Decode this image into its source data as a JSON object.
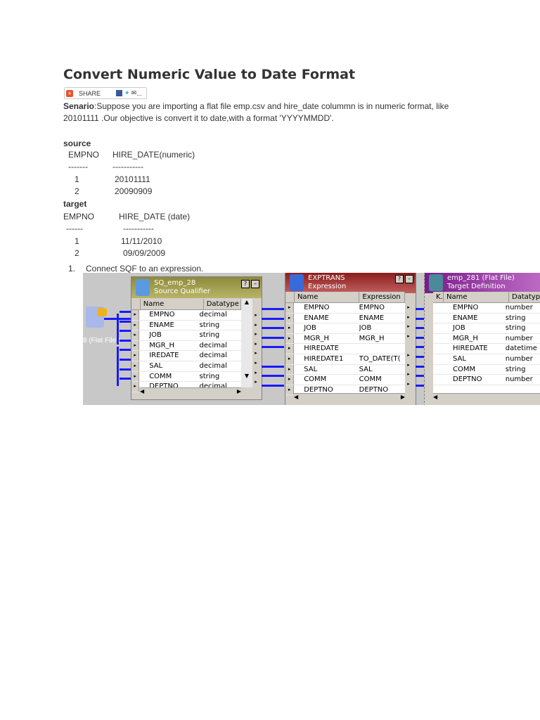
{
  "title": "Convert Numeric Value to Date Format",
  "share": {
    "label": "SHARE",
    "more": "..."
  },
  "scenario": {
    "label": "Senario",
    "text": ":Suppose you are importing a flat file emp.csv and hire_date colummn is in numeric format, like",
    "text2": "20101111 .Our objective is convert it to date,with a format 'YYYYMMDD'."
  },
  "source": {
    "label": "source",
    "headers": [
      "EMPNO",
      "HIRE_DATE(numeric)"
    ],
    "dashes": [
      "-------",
      "-----------"
    ],
    "rows": [
      [
        "1",
        "20101111"
      ],
      [
        "2",
        "20090909"
      ]
    ]
  },
  "target": {
    "label": "target",
    "headers": [
      "EMPNO",
      "HIRE_DATE (date)"
    ],
    "dashes": [
      "------",
      "-----------"
    ],
    "rows": [
      [
        "1",
        "11/11/2010"
      ],
      [
        "2",
        "09/09/2009"
      ]
    ]
  },
  "steps": [
    {
      "num": "1.",
      "text": "Connect SQF to an expression."
    }
  ],
  "diagram": {
    "source_label": "8 (Flat File )",
    "sq": {
      "title": "SQ_emp_28",
      "subtitle": "Source Qualifier",
      "col1": "Name",
      "col2": "Datatype",
      "rows": [
        [
          "EMPNO",
          "decimal"
        ],
        [
          "ENAME",
          "string"
        ],
        [
          "JOB",
          "string"
        ],
        [
          "MGR_H",
          "decimal"
        ],
        [
          "IREDATE",
          "decimal"
        ],
        [
          "SAL",
          "decimal"
        ],
        [
          "COMM",
          "string"
        ],
        [
          "DEPTNO",
          "decimal"
        ]
      ]
    },
    "exp": {
      "title": "EXPTRANS",
      "subtitle": "Expression",
      "col1": "Name",
      "col2": "Expression",
      "rows": [
        [
          "EMPNO",
          "EMPNO"
        ],
        [
          "ENAME",
          "ENAME"
        ],
        [
          "JOB",
          "JOB"
        ],
        [
          "MGR_H",
          "MGR_H"
        ],
        [
          "HIREDATE",
          ""
        ],
        [
          "HIREDATE1",
          "TO_DATE(T("
        ],
        [
          "SAL",
          "SAL"
        ],
        [
          "COMM",
          "COMM"
        ],
        [
          "DEPTNO",
          "DEPTNO"
        ]
      ]
    },
    "tgt": {
      "title": "emp_281 (Flat File)",
      "subtitle": "Target Definition",
      "col0": "K.",
      "col1": "Name",
      "col2": "Datatype",
      "rows": [
        [
          "EMPNO",
          "number"
        ],
        [
          "ENAME",
          "string"
        ],
        [
          "JOB",
          "string"
        ],
        [
          "MGR_H",
          "number"
        ],
        [
          "HIREDATE",
          "datetime"
        ],
        [
          "SAL",
          "number"
        ],
        [
          "COMM",
          "string"
        ],
        [
          "DEPTNO",
          "number"
        ]
      ]
    }
  }
}
